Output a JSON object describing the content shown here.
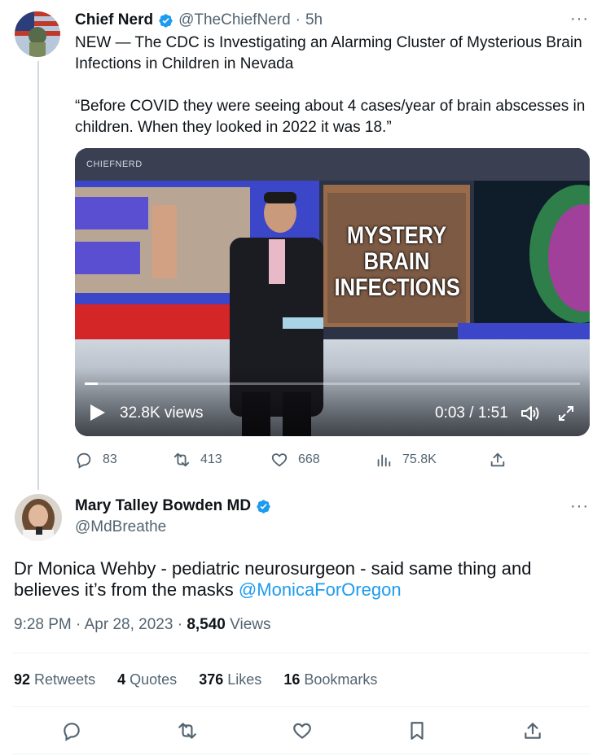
{
  "quoted": {
    "author_name": "Chief Nerd",
    "handle": "@TheChiefNerd",
    "dot": "·",
    "time": "5h",
    "more": "···",
    "text_p1": "NEW — The CDC is Investigating an Alarming Cluster of Mysterious Brain Infections in Children in Nevada",
    "text_p2": "“Before COVID they were seeing about 4 cases/year of brain abscesses in children. When they looked in 2022 it was 18.”",
    "video": {
      "watermark": "CHIEFNERD",
      "headline": [
        "MYSTERY",
        "BRAIN",
        "INFECTIONS"
      ],
      "views": "32.8K views",
      "time": "0:03 / 1:51",
      "progress": 0.027
    },
    "actions": {
      "replies": "83",
      "retweets": "413",
      "likes": "668",
      "views": "75.8K"
    }
  },
  "main": {
    "author_name": "Mary Talley Bowden MD",
    "handle": "@MdBreathe",
    "more": "···",
    "text": "Dr Monica Wehby - pediatric neurosurgeon - said same thing and believes it’s from the masks ",
    "mention": "@MonicaForOregon",
    "time": "9:28 PM",
    "date": "Apr 28, 2023",
    "view_count": "8,540",
    "views_label": "Views",
    "stats": {
      "retweets_count": "92",
      "retweets_label": "Retweets",
      "quotes_count": "4",
      "quotes_label": "Quotes",
      "likes_count": "376",
      "likes_label": "Likes",
      "bookmarks_count": "16",
      "bookmarks_label": "Bookmarks"
    }
  },
  "colors": {
    "accent": "#1d9bf0",
    "muted": "#536471",
    "verified": "#1d9bf0"
  }
}
